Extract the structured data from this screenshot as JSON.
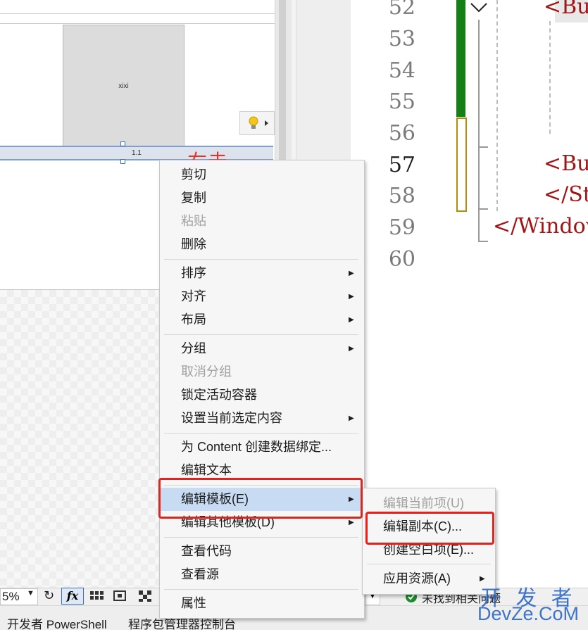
{
  "designer": {
    "button_text": "xixi",
    "selected_label": "1.1",
    "annotation": "右击"
  },
  "code_editor": {
    "lines": [
      {
        "num": "52",
        "code": "<But"
      },
      {
        "num": "53",
        "code": ""
      },
      {
        "num": "54",
        "code": ""
      },
      {
        "num": "55",
        "code": ""
      },
      {
        "num": "56",
        "code": ""
      },
      {
        "num": "57",
        "code": "<But"
      },
      {
        "num": "58",
        "code": "</St"
      },
      {
        "num": "59",
        "code": "</Window"
      },
      {
        "num": "60",
        "code": ""
      }
    ]
  },
  "status": {
    "zoom": "5%",
    "issues": "未找到相关问题",
    "bottom_tabs": [
      "开发者 PowerShell",
      "程序包管理器控制台"
    ]
  },
  "context_menu": {
    "items": [
      {
        "label": "剪切",
        "disabled": false
      },
      {
        "label": "复制",
        "disabled": false
      },
      {
        "label": "粘贴",
        "disabled": true
      },
      {
        "label": "删除",
        "disabled": false
      },
      {
        "label": "排序",
        "disabled": false,
        "submenu": true
      },
      {
        "label": "对齐",
        "disabled": false,
        "submenu": true
      },
      {
        "label": "布局",
        "disabled": false,
        "submenu": true
      },
      {
        "label": "分组",
        "disabled": false,
        "submenu": true
      },
      {
        "label": "取消分组",
        "disabled": true
      },
      {
        "label": "锁定活动容器",
        "disabled": false
      },
      {
        "label": "设置当前选定内容",
        "disabled": false,
        "submenu": true
      },
      {
        "label": "为 Content 创建数据绑定...",
        "disabled": false
      },
      {
        "label": "编辑文本",
        "disabled": false
      },
      {
        "label": "编辑模板(E)",
        "disabled": false,
        "submenu": true,
        "highlighted": true
      },
      {
        "label": "编辑其他模板(D)",
        "disabled": false,
        "submenu": true
      },
      {
        "label": "查看代码",
        "disabled": false
      },
      {
        "label": "查看源",
        "disabled": false
      },
      {
        "label": "属性",
        "disabled": false
      }
    ]
  },
  "submenu": {
    "items": [
      {
        "label": "编辑当前项(U)",
        "disabled": true
      },
      {
        "label": "编辑副本(C)...",
        "disabled": false
      },
      {
        "label": "创建空白项(E)...",
        "disabled": false
      },
      {
        "label": "应用资源(A)",
        "disabled": false,
        "submenu": true
      }
    ]
  },
  "watermark": {
    "line1": "开 发 者",
    "line2": "DevZe.CoM"
  },
  "colors": {
    "annotation_red": "#e8201a",
    "menu_highlight": "#c7dcf3",
    "change_green": "#158015",
    "change_yellow": "#b68d00"
  }
}
